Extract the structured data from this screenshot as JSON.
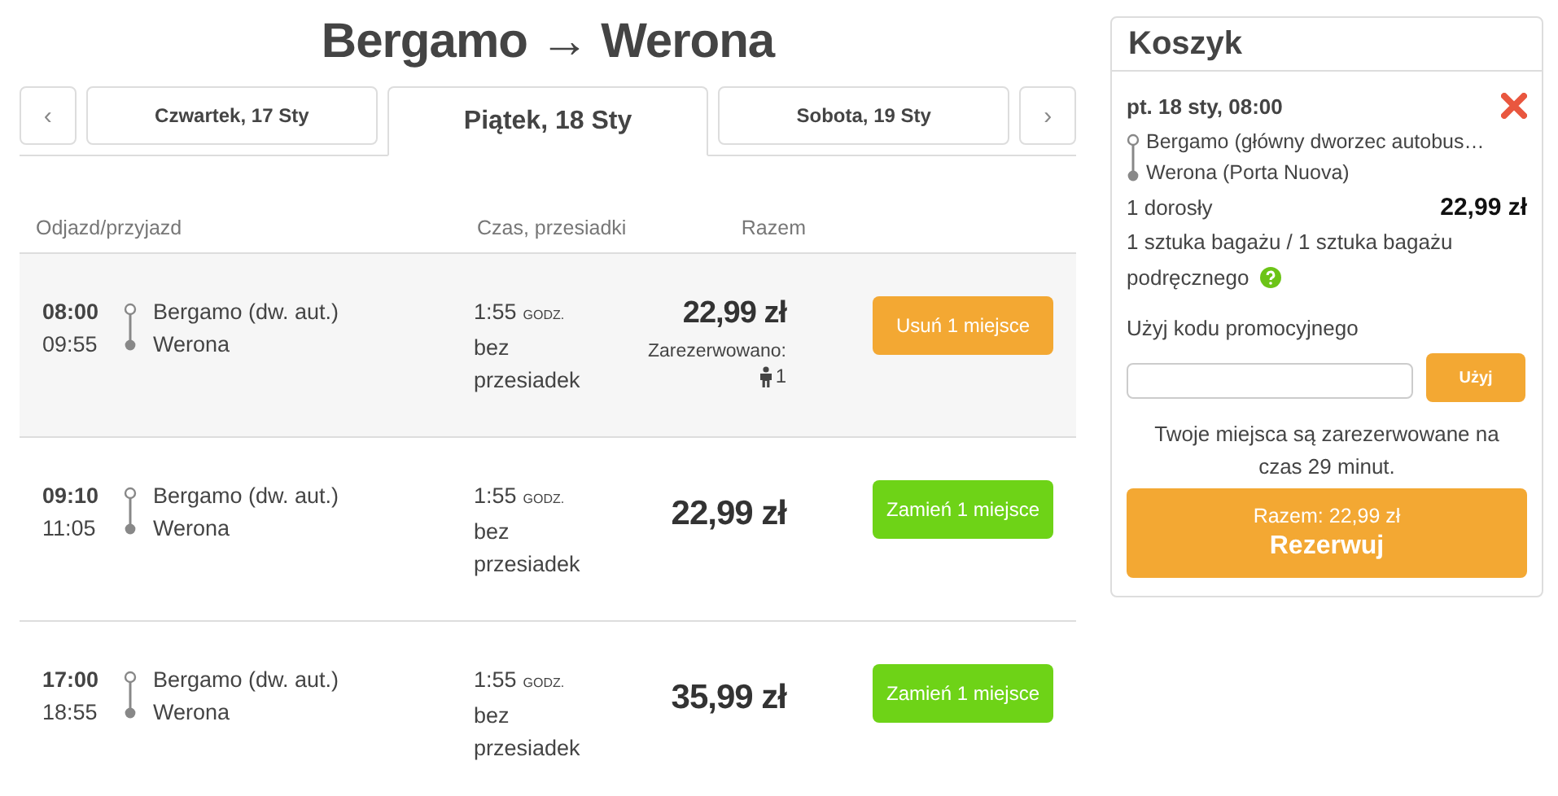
{
  "title": "Bergamo → Werona",
  "date_nav": {
    "prev": "‹",
    "next": "›",
    "tabs": [
      {
        "label": "Czwartek, 17 Sty",
        "selected": false
      },
      {
        "label": "Piątek, 18 Sty",
        "selected": true
      },
      {
        "label": "Sobota, 19 Sty",
        "selected": false
      }
    ]
  },
  "table": {
    "columns": [
      "Odjazd/przyjazd",
      "Czas, przesiadki",
      "Razem"
    ],
    "rows": [
      {
        "departure": "08:00",
        "arrival": "09:55",
        "from": "Bergamo (dw. aut.)",
        "to": "Werona",
        "duration": "1:55",
        "duration_unit": "GODZ.",
        "transfers": "bez przesiadek",
        "price": "22,99 zł",
        "reserved_label": "Zarezerwowano:",
        "reserved_count": "1",
        "selected": true,
        "action": "Usuń 1 miejsce"
      },
      {
        "departure": "09:10",
        "arrival": "11:05",
        "from": "Bergamo (dw. aut.)",
        "to": "Werona",
        "duration": "1:55",
        "duration_unit": "GODZ.",
        "transfers": "bez przesiadek",
        "price": "22,99 zł",
        "selected": false,
        "action": "Zamień 1 miejsce"
      },
      {
        "departure": "17:00",
        "arrival": "18:55",
        "from": "Bergamo (dw. aut.)",
        "to": "Werona",
        "duration": "1:55",
        "duration_unit": "GODZ.",
        "transfers": "bez przesiadek",
        "price": "35,99 zł",
        "selected": false,
        "action": "Zamień 1 miejsce"
      }
    ]
  },
  "cart": {
    "title": "Koszyk",
    "trip_date": "pt. 18 sty, 08:00",
    "from": "Bergamo (główny dworzec autobus…",
    "to": "Werona (Porta Nuova)",
    "passengers": "1 dorosły",
    "price": "22,99 zł",
    "luggage": [
      "1 sztuka bagażu / 1 sztuka bagażu",
      "podręcznego"
    ],
    "promo_label": "Użyj kodu promocyjnego",
    "promo_button": "Użyj",
    "notice": "Twoje miejsca są zarezerwowane na czas 29 minut.",
    "total": "Razem: 22,99 zł",
    "book_button": "Rezerwuj"
  }
}
